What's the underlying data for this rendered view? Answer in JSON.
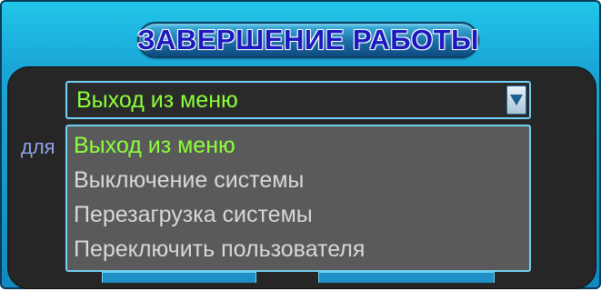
{
  "dialog": {
    "title": "ЗАВЕРШЕНИЕ РАБОТЫ",
    "side_label": "для"
  },
  "select": {
    "value": "Выход из меню",
    "dropdown_icon": "triangle-down-icon"
  },
  "dropdown": {
    "options": [
      "Выход из меню",
      "Выключение системы",
      "Перезагрузка системы",
      "Переключить пользователя"
    ],
    "selected_index": 0
  },
  "colors": {
    "frame": "#1aa5d6",
    "title_text": "#1b1ac0",
    "selected_text": "#8cff3a",
    "option_text": "#d8d8d8",
    "list_bg": "#5a5a5a",
    "border": "#6fd2f5"
  }
}
